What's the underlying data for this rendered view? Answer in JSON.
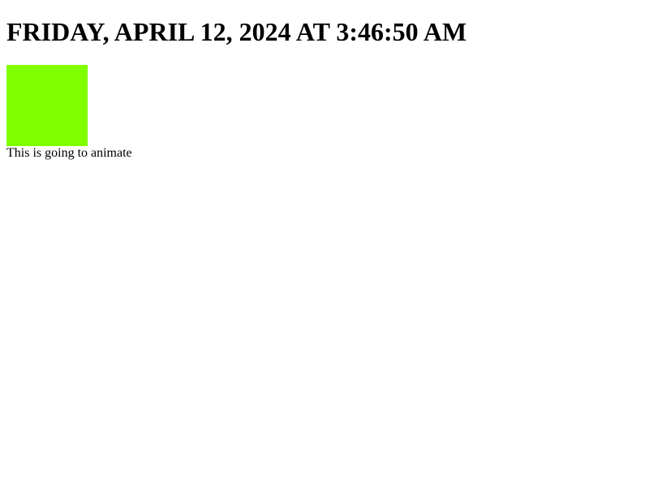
{
  "header": {
    "datetime_text": "FRIDAY, APRIL 12, 2024 AT 3:46:50 AM"
  },
  "animation": {
    "box_color": "#80ff00",
    "caption": "This is going to animate"
  }
}
